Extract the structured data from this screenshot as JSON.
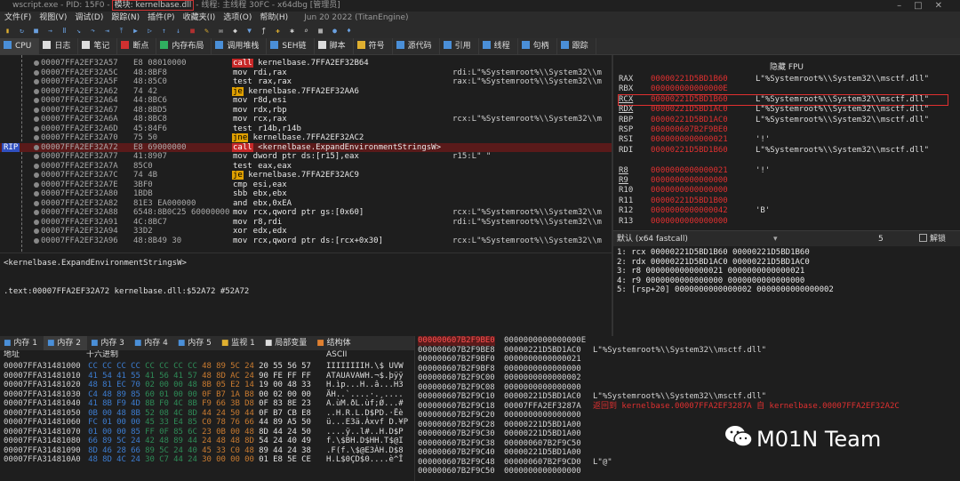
{
  "window": {
    "title_pre": "wscript.exe - PID: 15F0 -",
    "title_module": "模块: kernelbase.dll",
    "title_post": "- 线程: 主线程 30FC - x64dbg [管理员]"
  },
  "menu": {
    "items": [
      "文件(F)",
      "视图(V)",
      "调试(D)",
      "跟踪(N)",
      "插件(P)",
      "收藏夹(I)",
      "选项(O)",
      "帮助(H)"
    ],
    "subtitle": "Jun 20 2022 (TitanEngine)"
  },
  "toolbar": {
    "icons": [
      {
        "name": "open-icon",
        "glyph": "▮",
        "color": "#e0b030"
      },
      {
        "name": "restart-icon",
        "glyph": "↻",
        "color": "#6aa0e0"
      },
      {
        "name": "close-icon",
        "glyph": "■",
        "color": "#6aa0e0"
      },
      {
        "name": "run-icon",
        "glyph": "→",
        "color": "#6aa0e0"
      },
      {
        "name": "pause-icon",
        "glyph": "Ⅱ",
        "color": "#6aa0e0"
      },
      {
        "name": "step-into-icon",
        "glyph": "↘",
        "color": "#6aa0e0"
      },
      {
        "name": "step-over-icon",
        "glyph": "↷",
        "color": "#6aa0e0"
      },
      {
        "name": "run-to-user-icon",
        "glyph": "⇥",
        "color": "#6aa0e0"
      },
      {
        "name": "execute-till-return-icon",
        "glyph": "⤒",
        "color": "#6aa0e0"
      },
      {
        "name": "animate-into-icon",
        "glyph": "▶",
        "color": "#6aa0e0"
      },
      {
        "name": "animate-over-icon",
        "glyph": "▷",
        "color": "#6aa0e0"
      },
      {
        "name": "trace-into-icon",
        "glyph": "↑",
        "color": "#6aa0e0"
      },
      {
        "name": "trace-over-icon",
        "glyph": "↓",
        "color": "#6aa0e0"
      },
      {
        "name": "stop-trace-icon",
        "glyph": "■",
        "color": "#b03030"
      },
      {
        "name": "pen-icon",
        "glyph": "✎",
        "color": "#e0b030"
      },
      {
        "name": "comment-icon",
        "glyph": "✉",
        "color": "#d0d0d0"
      },
      {
        "name": "label-icon",
        "glyph": "◆",
        "color": "#d0d0d0"
      },
      {
        "name": "bookmark-icon",
        "glyph": "▼",
        "color": "#6aa0e0"
      },
      {
        "name": "function-icon",
        "glyph": "ƒ",
        "color": "#d0d0d0"
      },
      {
        "name": "script-icon",
        "glyph": "✚",
        "color": "#e0b030"
      },
      {
        "name": "patch-icon",
        "glyph": "✱",
        "color": "#d0d0d0"
      },
      {
        "name": "find-icon",
        "glyph": "⌕",
        "color": "#d0d0d0"
      },
      {
        "name": "calculator-icon",
        "glyph": "▦",
        "color": "#d0d0d0"
      },
      {
        "name": "help-icon",
        "glyph": "●",
        "color": "#6aa0e0"
      },
      {
        "name": "lightbulb-icon",
        "glyph": "♦",
        "color": "#6aa0e0"
      }
    ]
  },
  "tabs": [
    {
      "label": "CPU",
      "icon": "cpu-icon",
      "color": "#4a8fd8",
      "active": true
    },
    {
      "label": "日志",
      "icon": "log-icon",
      "color": "#dddddd"
    },
    {
      "label": "笔记",
      "icon": "notes-icon",
      "color": "#dddddd"
    },
    {
      "label": "断点",
      "icon": "breakpoint-icon",
      "color": "#d03030"
    },
    {
      "label": "内存布局",
      "icon": "memory-map-icon",
      "color": "#30b060"
    },
    {
      "label": "调用堆栈",
      "icon": "call-stack-icon",
      "color": "#4a8fd8"
    },
    {
      "label": "SEH链",
      "icon": "seh-icon",
      "color": "#4a8fd8"
    },
    {
      "label": "脚本",
      "icon": "script-tab-icon",
      "color": "#dddddd"
    },
    {
      "label": "符号",
      "icon": "symbols-icon",
      "color": "#e0b030"
    },
    {
      "label": "源代码",
      "icon": "source-icon",
      "color": "#4a8fd8"
    },
    {
      "label": "引用",
      "icon": "references-icon",
      "color": "#4a8fd8"
    },
    {
      "label": "线程",
      "icon": "threads-icon",
      "color": "#4a8fd8"
    },
    {
      "label": "句柄",
      "icon": "handles-icon",
      "color": "#4a8fd8"
    },
    {
      "label": "跟踪",
      "icon": "trace-icon",
      "color": "#4a8fd8"
    }
  ],
  "disasm": {
    "rip_label": "RIP",
    "rows": [
      {
        "addr": "00007FFA2EF32A57",
        "bytes": "E8 08010000",
        "mn": "call",
        "op": "kernelbase.7FFA2EF32B64",
        "cmt": "",
        "cls": "call"
      },
      {
        "addr": "00007FFA2EF32A5C",
        "bytes": "48:8BF8",
        "mn": "mov",
        "op": "rdi,rax",
        "cmt": "rdi:L\"%Systemroot%\\\\System32\\\\m",
        "cls": ""
      },
      {
        "addr": "00007FFA2EF32A5F",
        "bytes": "48:85C0",
        "mn": "test",
        "op": "rax,rax",
        "cmt": "rax:L\"%Systemroot%\\\\System32\\\\m",
        "cls": ""
      },
      {
        "addr": "00007FFA2EF32A62",
        "bytes": "74 42",
        "mn": "je",
        "op": "kernelbase.7FFA2EF32AA6",
        "cmt": "",
        "cls": "jx"
      },
      {
        "addr": "00007FFA2EF32A64",
        "bytes": "44:8BC6",
        "mn": "mov",
        "op": "r8d,esi",
        "cmt": "",
        "cls": ""
      },
      {
        "addr": "00007FFA2EF32A67",
        "bytes": "48:8BD5",
        "mn": "mov",
        "op": "rdx,rbp",
        "cmt": "",
        "cls": ""
      },
      {
        "addr": "00007FFA2EF32A6A",
        "bytes": "48:8BC8",
        "mn": "mov",
        "op": "rcx,rax",
        "cmt": "rcx:L\"%Systemroot%\\\\System32\\\\m",
        "cls": ""
      },
      {
        "addr": "00007FFA2EF32A6D",
        "bytes": "45:84F6",
        "mn": "test",
        "op": "r14b,r14b",
        "cmt": "",
        "cls": ""
      },
      {
        "addr": "00007FFA2EF32A70",
        "bytes": "75 50",
        "mn": "jne",
        "op": "kernelbase.7FFA2EF32AC2",
        "cmt": "",
        "cls": "jx"
      },
      {
        "addr": "00007FFA2EF32A72",
        "bytes": "E8 69000000",
        "mn": "call",
        "op": "<kernelbase.ExpandEnvironmentStringsW>",
        "cmt": "",
        "cls": "call",
        "rip": true
      },
      {
        "addr": "00007FFA2EF32A77",
        "bytes": "41:8907",
        "mn": "mov",
        "op": "dword ptr ds:[r15],eax",
        "cmt": "r15:L\" \"",
        "cls": ""
      },
      {
        "addr": "00007FFA2EF32A7A",
        "bytes": "85C0",
        "mn": "test",
        "op": "eax,eax",
        "cmt": "",
        "cls": ""
      },
      {
        "addr": "00007FFA2EF32A7C",
        "bytes": "74 4B",
        "mn": "je",
        "op": "kernelbase.7FFA2EF32AC9",
        "cmt": "",
        "cls": "jx"
      },
      {
        "addr": "00007FFA2EF32A7E",
        "bytes": "3BF0",
        "mn": "cmp",
        "op": "esi,eax",
        "cmt": "",
        "cls": ""
      },
      {
        "addr": "00007FFA2EF32A80",
        "bytes": "1BDB",
        "mn": "sbb",
        "op": "ebx,ebx",
        "cmt": "",
        "cls": ""
      },
      {
        "addr": "00007FFA2EF32A82",
        "bytes": "81E3 EA000000",
        "mn": "and",
        "op": "ebx,0xEA",
        "cmt": "",
        "cls": ""
      },
      {
        "addr": "00007FFA2EF32A88",
        "bytes": "6548:8B0C25 60000000",
        "mn": "mov",
        "op": "rcx,qword ptr gs:[0x60]",
        "cmt": "rcx:L\"%Systemroot%\\\\System32\\\\m",
        "cls": ""
      },
      {
        "addr": "00007FFA2EF32A91",
        "bytes": "4C:8BC7",
        "mn": "mov",
        "op": "r8,rdi",
        "cmt": "rdi:L\"%Systemroot%\\\\System32\\\\m",
        "cls": ""
      },
      {
        "addr": "00007FFA2EF32A94",
        "bytes": "33D2",
        "mn": "xor",
        "op": "edx,edx",
        "cmt": "",
        "cls": ""
      },
      {
        "addr": "00007FFA2EF32A96",
        "bytes": "48:8B49 30",
        "mn": "mov",
        "op": "rcx,qword ptr ds:[rcx+0x30]",
        "cmt": "rcx:L\"%Systemroot%\\\\System32\\\\m",
        "cls": ""
      }
    ]
  },
  "info": {
    "line1": "<kernelbase.ExpandEnvironmentStringsW>",
    "line2": ".text:00007FFA2EF32A72 kernelbase.dll:$52A72 #52A72"
  },
  "registers": {
    "header": "隐藏 FPU",
    "rows": [
      {
        "n": "RAX",
        "v": "00000221D5BD1B60",
        "s": "L\"%Systemroot%\\\\System32\\\\msctf.dll\""
      },
      {
        "n": "RBX",
        "v": "000000000000000E",
        "s": ""
      },
      {
        "n": "RCX",
        "v": "00000221D5BD1B60",
        "s": "L\"%Systemroot%\\\\System32\\\\msctf.dll\"",
        "boxed": true,
        "ul": true
      },
      {
        "n": "RDX",
        "v": "00000221D5BD1AC0",
        "s": "L\"%Systemroot%\\\\System32\\\\msctf.dll\"",
        "ul": true
      },
      {
        "n": "RBP",
        "v": "00000221D5BD1AC0",
        "s": "L\"%Systemroot%\\\\System32\\\\msctf.dll\""
      },
      {
        "n": "RSP",
        "v": "000000607B2F9BE0",
        "s": ""
      },
      {
        "n": "RSI",
        "v": "0000000000000021",
        "s": "'!'"
      },
      {
        "n": "RDI",
        "v": "00000221D5BD1B60",
        "s": "L\"%Systemroot%\\\\System32\\\\msctf.dll\""
      },
      {
        "n": "",
        "v": "",
        "s": ""
      },
      {
        "n": "R8",
        "v": "0000000000000021",
        "s": "'!'",
        "ul": true
      },
      {
        "n": "R9",
        "v": "0000000000000000",
        "s": "",
        "ul": true
      },
      {
        "n": "R10",
        "v": "0000000000000000",
        "s": ""
      },
      {
        "n": "R11",
        "v": "00000221D5BD1B00",
        "s": ""
      },
      {
        "n": "R12",
        "v": "0000000000000042",
        "s": "'B'"
      },
      {
        "n": "R13",
        "v": "0000000000000000",
        "s": ""
      }
    ]
  },
  "callconv": {
    "label": "默认 (x64 fastcall)",
    "count": "5",
    "unlock": "解锁"
  },
  "args": [
    "1: rcx 00000221D5BD1B60 00000221D5BD1B60",
    "2: rdx 00000221D5BD1AC0 00000221D5BD1AC0",
    "3: r8 0000000000000021 0000000000000021",
    "4: r9 0000000000000000 0000000000000000",
    "5: [rsp+20] 0000000000000002 0000000000000002"
  ],
  "bottom_tabs": [
    {
      "label": "内存 1",
      "icon": "memory-icon",
      "color": "#4a8fd8"
    },
    {
      "label": "内存 2",
      "icon": "memory-icon",
      "color": "#4a8fd8",
      "active": true
    },
    {
      "label": "内存 3",
      "icon": "memory-icon",
      "color": "#4a8fd8"
    },
    {
      "label": "内存 4",
      "icon": "memory-icon",
      "color": "#4a8fd8"
    },
    {
      "label": "内存 5",
      "icon": "memory-icon",
      "color": "#4a8fd8"
    },
    {
      "label": "监视 1",
      "icon": "watch-icon",
      "color": "#e0b030"
    },
    {
      "label": "局部变量",
      "icon": "locals-icon",
      "color": "#dddddd"
    },
    {
      "label": "结构体",
      "icon": "struct-icon",
      "color": "#e08030"
    }
  ],
  "dump": {
    "h_addr": "地址",
    "h_hex": "十六进制",
    "h_ascii": "ASCII",
    "rows": [
      {
        "addr": "00007FFA31481000",
        "hex": "CC CC CC CC CC CC CC CC 48 89 5C 24 20 55 56 57",
        "ascii": "IIIIIIIIH.\\$ UVW"
      },
      {
        "addr": "00007FFA31481010",
        "hex": "41 54 41 55 41 56 41 57 48 8D AC 24 90 FE FF FF",
        "ascii": "ATAUAVAWH.¬$.þÿÿ"
      },
      {
        "addr": "00007FFA31481020",
        "hex": "48 81 EC 70 02 00 00 48 8B 05 E2 14 19 00 48 33",
        "ascii": "H.ìp...H..â...H3"
      },
      {
        "addr": "00007FFA31481030",
        "hex": "C4 48 89 85 60 01 00 00 0F B7 1A B8 00 02 00 00",
        "ascii": "ÄH..`....·.¸...."
      },
      {
        "addr": "00007FFA31481040",
        "hex": "41 8B F9 4D 8B F0 4C 8B F9 66 3B D8 0F 83 8E 23",
        "ascii": "A.ùM.ðL.ùf;Ø...#"
      },
      {
        "addr": "00007FFA31481050",
        "hex": "0B 00 48 8B 52 08 4C 8D 44 24 50 44 0F B7 CB E8",
        "ascii": "..H.R.L.D$PD.·Ëè"
      },
      {
        "addr": "00007FFA31481060",
        "hex": "FC 01 00 00 45 33 E4 85 C0 78 76 66 44 89 A5 50",
        "ascii": "ü...E3ä.Àxvf D.¥P"
      },
      {
        "addr": "00007FFA31481070",
        "hex": "01 00 00 85 FF 0F 85 6C 23 0B 00 48 8D 44 24 50",
        "ascii": "....ÿ..l#..H.D$P"
      },
      {
        "addr": "00007FFA31481080",
        "hex": "66 89 5C 24 42 48 89 44 24 48 48 8D 54 24 40 49",
        "ascii": "f.\\$BH.D$HH.T$@I"
      },
      {
        "addr": "00007FFA31481090",
        "hex": "8D 46 28 66 89 5C 24 40 45 33 C0 48 89 44 24 38",
        "ascii": ".F(f.\\$@E3ÀH.D$8"
      },
      {
        "addr": "00007FFA314810A0",
        "hex": "48 8D 4C 24 30 C7 44 24 30 00 00 00 01 E8 5E CE",
        "ascii": "H.L$0ÇD$0....è^Î"
      }
    ]
  },
  "stack": {
    "rows": [
      {
        "addr": "000000607B2F9BE0",
        "val": "0000000000000000E",
        "cmt": "",
        "top": true
      },
      {
        "addr": "000000607B2F9BE8",
        "val": "00000221D5BD1AC0",
        "cmt": "L\"%Systemroot%\\\\System32\\\\msctf.dll\""
      },
      {
        "addr": "000000607B2F9BF0",
        "val": "0000000000000021",
        "cmt": ""
      },
      {
        "addr": "000000607B2F9BF8",
        "val": "0000000000000000",
        "cmt": ""
      },
      {
        "addr": "000000607B2F9C00",
        "val": "0000000000000002",
        "cmt": ""
      },
      {
        "addr": "000000607B2F9C08",
        "val": "0000000000000000",
        "cmt": ""
      },
      {
        "addr": "000000607B2F9C10",
        "val": "00000221D5BD1AC0",
        "cmt": "L\"%Systemroot%\\\\System32\\\\msctf.dll\""
      },
      {
        "addr": "000000607B2F9C18",
        "val": "00007FFA2EF3287A",
        "cmt": "返回到 kernelbase.00007FFA2EF3287A 自 kernelbase.00007FFA2EF32A2C",
        "red": true
      },
      {
        "addr": "000000607B2F9C20",
        "val": "0000000000000000",
        "cmt": ""
      },
      {
        "addr": "000000607B2F9C28",
        "val": "00000221D5BD1A00",
        "cmt": ""
      },
      {
        "addr": "000000607B2F9C30",
        "val": "00000221D5BD1A00",
        "cmt": ""
      },
      {
        "addr": "000000607B2F9C38",
        "val": "000000607B2F9C50",
        "cmt": ""
      },
      {
        "addr": "000000607B2F9C40",
        "val": "00000221D5BD1A00",
        "cmt": ""
      },
      {
        "addr": "000000607B2F9C48",
        "val": "000000607B2F9CD0",
        "cmt": "L\"@\""
      },
      {
        "addr": "000000607B2F9C50",
        "val": "0000000000000000",
        "cmt": ""
      }
    ]
  },
  "watermark": {
    "text": "M01N Team"
  }
}
